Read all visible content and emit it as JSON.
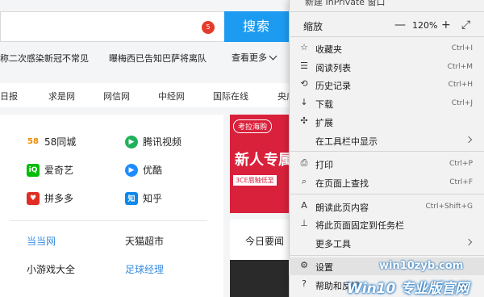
{
  "search": {
    "badge": "5",
    "button": "搜索"
  },
  "hot": {
    "items": [
      "称二次感染新冠不常见",
      "曝梅西已告知巴萨将离队"
    ],
    "more": "查看更多"
  },
  "sites": [
    "日报",
    "求是网",
    "网信网",
    "中经网",
    "国际在线",
    "央广"
  ],
  "apps": [
    {
      "label": "58同城",
      "icon": "58",
      "color": "#f08a00"
    },
    {
      "label": "腾讯视频",
      "icon": "▶",
      "color": "#21b15a"
    },
    {
      "label": "爱奇艺",
      "icon": "iQ",
      "color": "#00be06"
    },
    {
      "label": "优酷",
      "icon": "▶",
      "color": "#1e8cff"
    },
    {
      "label": "拼多多",
      "icon": "♥",
      "color": "#e02e24"
    },
    {
      "label": "知乎",
      "icon": "知",
      "color": "#0f88eb"
    }
  ],
  "links": [
    {
      "label": "当当网",
      "color": "#3a8de0"
    },
    {
      "label": "天猫超市",
      "color": "#222222"
    },
    {
      "label": "小游戏大全",
      "color": "#222222"
    },
    {
      "label": "足球经理",
      "color": "#3a8de0"
    }
  ],
  "banner": {
    "logo": "考拉海购",
    "title": "新人专属",
    "sub": "3CE唇釉低至"
  },
  "news": {
    "title": "今日要闻"
  },
  "menu": {
    "top_cut": "新建 InPrivate 窗口",
    "zoom": {
      "label": "缩放",
      "minus": "—",
      "value": "120%",
      "plus": "+",
      "full": "⤢"
    },
    "items": [
      {
        "label": "收藏夹",
        "shortcut": "Ctrl+I",
        "icon": "☆"
      },
      {
        "label": "阅读列表",
        "shortcut": "Ctrl+M",
        "icon": "☰"
      },
      {
        "label": "历史记录",
        "shortcut": "Ctrl+H",
        "icon": "⟲"
      },
      {
        "label": "下载",
        "shortcut": "Ctrl+J",
        "icon": "↓"
      },
      {
        "label": "扩展",
        "shortcut": "",
        "icon": "✣"
      },
      {
        "label": "在工具栏中显示",
        "shortcut": "",
        "icon": ""
      },
      {
        "label": "打印",
        "shortcut": "Ctrl+P",
        "icon": "⎙"
      },
      {
        "label": "在页面上查找",
        "shortcut": "Ctrl+F",
        "icon": "⌕"
      },
      {
        "label": "朗读此页内容",
        "shortcut": "Ctrl+Shift+G",
        "icon": "A"
      },
      {
        "label": "将此页面固定到任务栏",
        "shortcut": "",
        "icon": "⊥"
      },
      {
        "label": "更多工具",
        "shortcut": "",
        "icon": ""
      },
      {
        "label": "设置",
        "shortcut": "",
        "icon": "⚙"
      },
      {
        "label": "帮助和反馈",
        "shortcut": "",
        "icon": "?"
      }
    ]
  },
  "watermark": {
    "site": "win10zyb.com",
    "main": "Win10 专业版官网"
  }
}
